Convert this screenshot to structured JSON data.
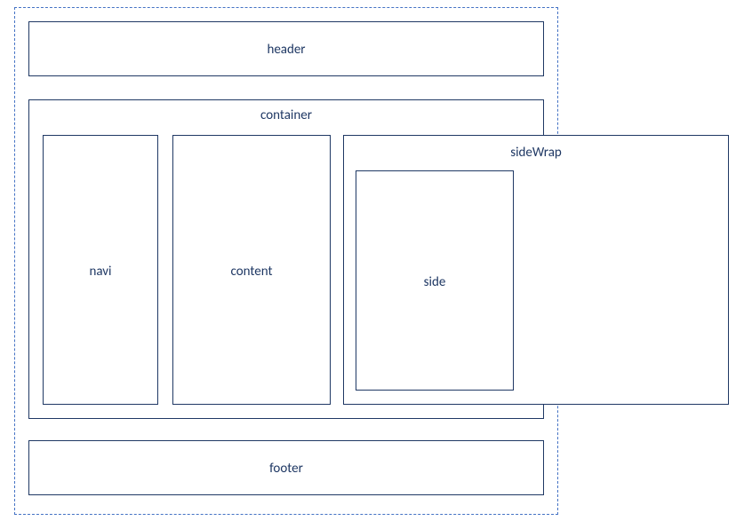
{
  "labels": {
    "header": "header",
    "container": "container",
    "navi": "navi",
    "content": "content",
    "sideWrap": "sideWrap",
    "side": "side",
    "footer": "footer"
  }
}
